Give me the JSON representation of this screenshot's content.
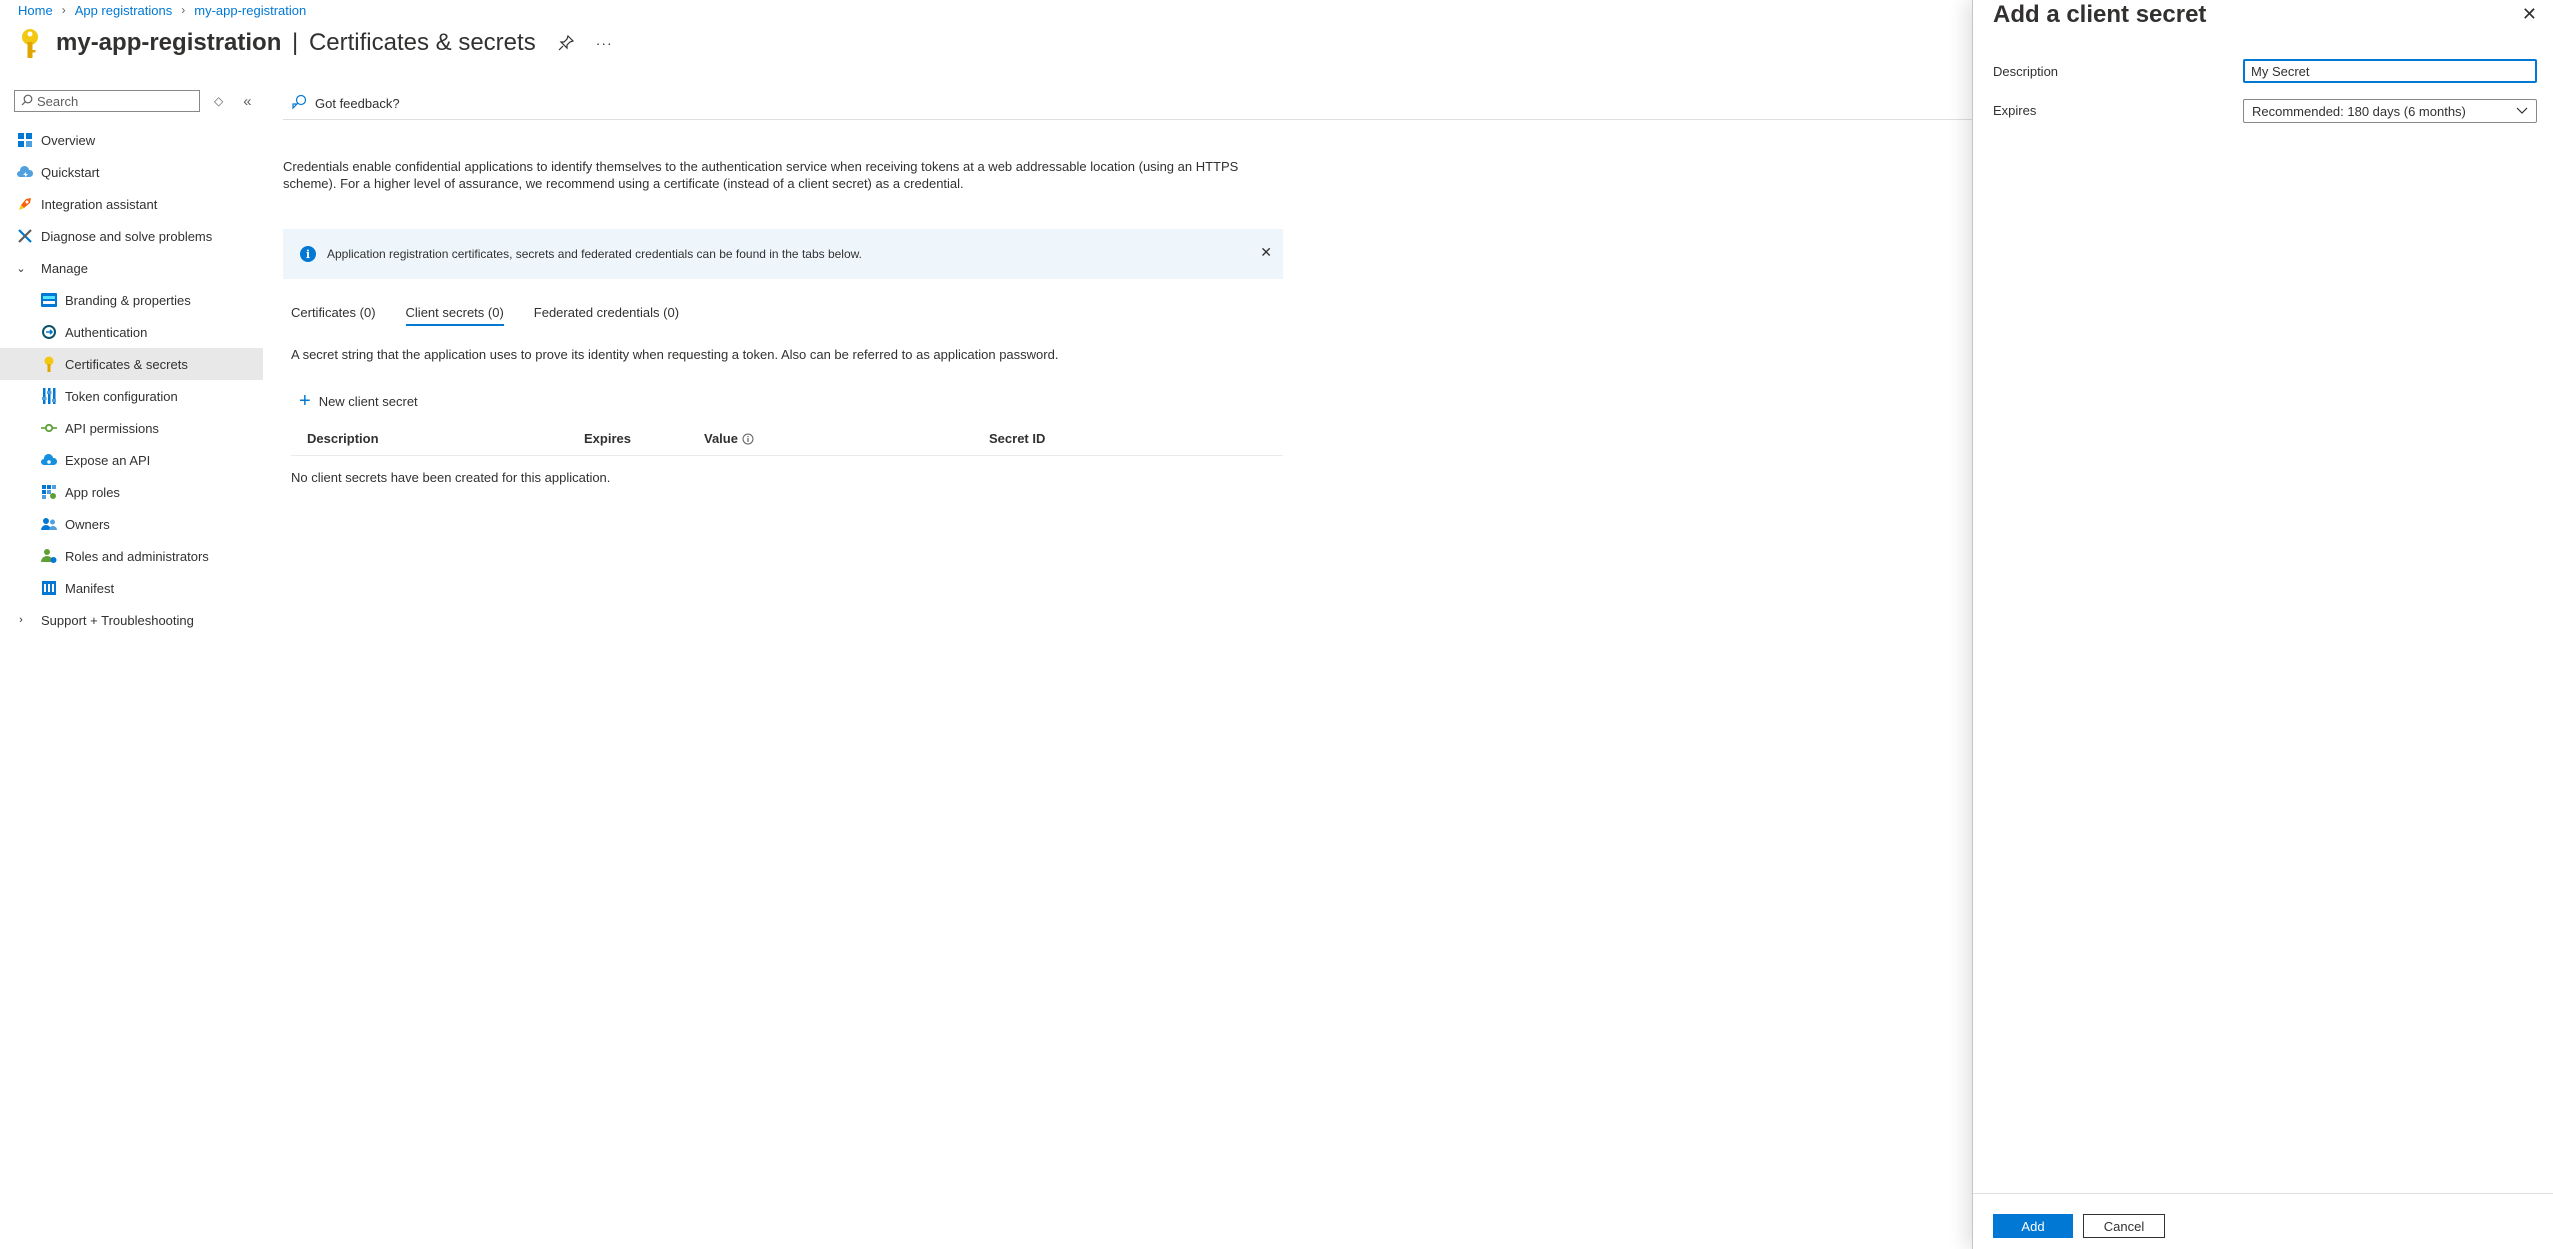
{
  "breadcrumb": {
    "items": [
      "Home",
      "App registrations",
      "my-app-registration"
    ]
  },
  "header": {
    "app_name": "my-app-registration",
    "divider": "|",
    "page_name": "Certificates & secrets",
    "more_label": "···"
  },
  "sidebar": {
    "search_placeholder": "Search",
    "items": [
      {
        "label": "Overview",
        "icon": "grid-icon"
      },
      {
        "label": "Quickstart",
        "icon": "cloud-quickstart-icon"
      },
      {
        "label": "Integration assistant",
        "icon": "rocket-icon"
      },
      {
        "label": "Diagnose and solve problems",
        "icon": "wrench-icon"
      },
      {
        "label": "Manage",
        "icon": "chevron-down-icon"
      },
      {
        "label": "Branding & properties",
        "icon": "branding-icon"
      },
      {
        "label": "Authentication",
        "icon": "authentication-icon"
      },
      {
        "label": "Certificates & secrets",
        "icon": "key-icon"
      },
      {
        "label": "Token configuration",
        "icon": "token-config-icon"
      },
      {
        "label": "API permissions",
        "icon": "api-permissions-icon"
      },
      {
        "label": "Expose an API",
        "icon": "cloud-api-icon"
      },
      {
        "label": "App roles",
        "icon": "app-roles-icon"
      },
      {
        "label": "Owners",
        "icon": "owners-icon"
      },
      {
        "label": "Roles and administrators",
        "icon": "roles-admin-icon"
      },
      {
        "label": "Manifest",
        "icon": "manifest-icon"
      },
      {
        "label": "Support + Troubleshooting",
        "icon": "chevron-right-icon"
      }
    ]
  },
  "commandbar": {
    "feedback_label": "Got feedback?"
  },
  "main": {
    "intro": "Credentials enable confidential applications to identify themselves to the authentication service when receiving tokens at a web addressable location (using an HTTPS scheme). For a higher level of assurance, we recommend using a certificate (instead of a client secret) as a credential.",
    "info_message": "Application registration certificates, secrets and federated credentials can be found in the tabs below.",
    "tabs": [
      {
        "label": "Certificates (0)"
      },
      {
        "label": "Client secrets (0)"
      },
      {
        "label": "Federated credentials (0)"
      }
    ],
    "tab_description": "A secret string that the application uses to prove its identity when requesting a token. Also can be referred to as application password.",
    "new_secret_label": "New client secret",
    "table": {
      "columns": [
        "Description",
        "Expires",
        "Value",
        "Secret ID"
      ],
      "empty_message": "No client secrets have been created for this application."
    }
  },
  "panel": {
    "title": "Add a client secret",
    "description_label": "Description",
    "description_value": "My Secret",
    "expires_label": "Expires",
    "expires_value": "Recommended: 180 days (6 months)",
    "add_label": "Add",
    "cancel_label": "Cancel"
  },
  "colors": {
    "accent": "#0078d4",
    "info_bg": "#eef6fc",
    "active_nav_bg": "#e8e8e8",
    "key_yellow": "#f2c811"
  }
}
